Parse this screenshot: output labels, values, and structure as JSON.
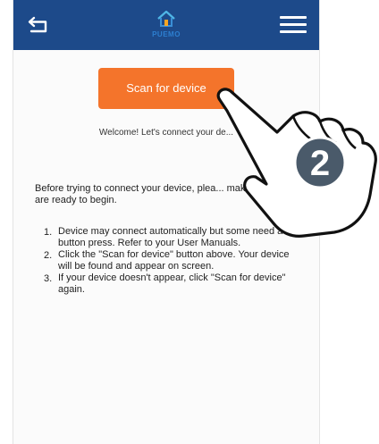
{
  "header": {
    "logo_text": "PUEMO",
    "back_icon": "back-arrow-icon",
    "menu_icon": "hamburger-menu-icon",
    "bg_color": "#1d4a8a"
  },
  "main": {
    "scan_button_label": "Scan for device",
    "scan_button_color": "#f4742b",
    "welcome_text": "Welcome! Let's connect your de...",
    "intro_text": "Before trying to connect your device, plea... make sure they are ready to begin.",
    "steps": [
      {
        "number": "1.",
        "text": "Device may connect automatically but some need a button press. Refer to your User Manuals."
      },
      {
        "number": "2.",
        "text": "Click the \"Scan for device\" button above. Your device will be found and appear on screen."
      },
      {
        "number": "3.",
        "text": "If your device doesn't appear, click \"Scan for device\" again."
      }
    ]
  },
  "overlay": {
    "hand_icon": "pointing-hand-icon",
    "step_badge": "2"
  }
}
